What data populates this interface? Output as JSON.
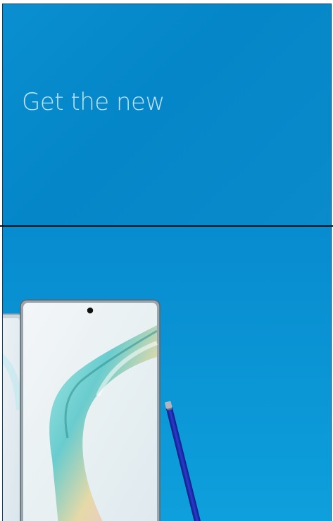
{
  "banner": {
    "headline": "Get the new"
  },
  "colors": {
    "brand_blue": "#0786c8",
    "headline_text": "#bfe3f6",
    "divider": "#111111",
    "stylus_blue": "#1a2bb0"
  },
  "icons": {
    "front_camera": "camera-dot-icon"
  }
}
